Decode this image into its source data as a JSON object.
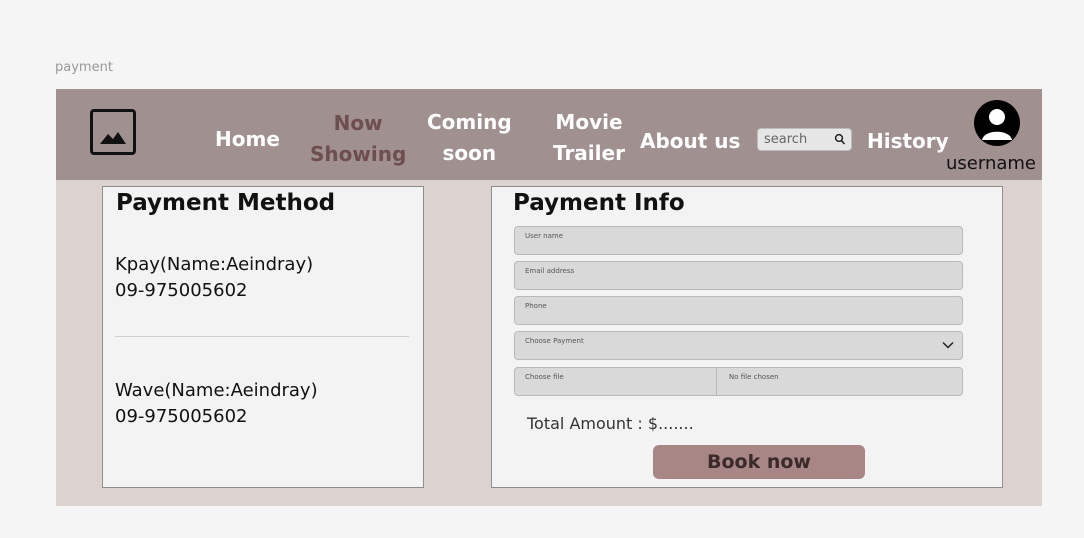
{
  "frame_label": "payment",
  "navbar": {
    "items": [
      {
        "line1": "Home",
        "line2": ""
      },
      {
        "line1": "Now",
        "line2": "Showing"
      },
      {
        "line1": "Coming",
        "line2": "soon"
      },
      {
        "line1": "Movie",
        "line2": "Trailer"
      },
      {
        "line1": "About us",
        "line2": ""
      },
      {
        "line1": "History",
        "line2": ""
      }
    ],
    "active_item": "Now Showing",
    "search_placeholder": "search",
    "username": "username"
  },
  "payment_method": {
    "title": "Payment Method",
    "methods": [
      {
        "name": "Kpay(Name:Aeindray)",
        "phone": "09-975005602"
      },
      {
        "name": "Wave(Name:Aeindray)",
        "phone": "09-975005602"
      }
    ]
  },
  "payment_info": {
    "title": "Payment Info",
    "fields": {
      "user_name": "User name",
      "email": "Email address",
      "phone": "Phone",
      "choose_payment": "Choose Payment",
      "choose_file": "Choose file",
      "no_file": "No file chosen"
    },
    "total": "Total Amount : $.......",
    "book_label": "Book now"
  },
  "colors": {
    "navbar": "#a09090",
    "frame_bg": "#dcd2d0",
    "active_nav": "#6e4e4e",
    "book_button": "#a98686"
  },
  "icons": [
    "image-placeholder-icon",
    "search-icon",
    "user-avatar-icon",
    "chevron-down-icon"
  ]
}
